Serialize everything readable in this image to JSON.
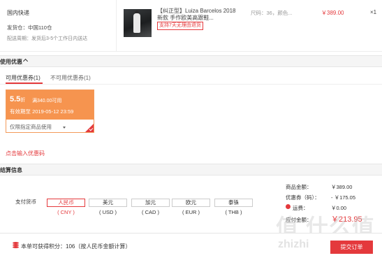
{
  "shipping": {
    "title": "国内快递",
    "from_line": "发货仓：中国110仓",
    "delivery_line": "配送周期：发货后3-5个工作日内送达"
  },
  "product": {
    "title": "【纠正型】Luiza Barcelos 2018新款 手作欧美高跟鞋...",
    "tag": "支持7天无理由退货",
    "sku": "尺码：36，颜色...",
    "price": "￥389.00",
    "qty": "×1"
  },
  "coupon_section": {
    "header": "使用优惠",
    "tab_usable": "可用优惠券(1)",
    "tab_unusable": "不可用优惠券(1)",
    "coupon": {
      "discount": "5.5",
      "discount_unit": "折",
      "condition": "满340.00可用",
      "valid": "有效期至 2019-05-12 23:59",
      "scope": "仅限指定商品使用"
    },
    "redeem_link": "点击输入优惠码"
  },
  "settlement": {
    "header": "结算信息",
    "currency_label": "支付货币",
    "currencies": [
      {
        "name": "人民币",
        "code": "( CNY )"
      },
      {
        "name": "美元",
        "code": "( USD )"
      },
      {
        "name": "加元",
        "code": "( CAD )"
      },
      {
        "name": "欧元",
        "code": "( EUR )"
      },
      {
        "name": "泰铢",
        "code": "( THB )"
      }
    ],
    "selected_currency": "CNY",
    "summary": {
      "goods_label": "商品金额：",
      "goods_value": "￥389.00",
      "coupon_label": "优惠券（码）：",
      "coupon_value": "- ￥175.05",
      "other_label": "运费：",
      "other_value": "￥0.00",
      "total_label": "应付金额：",
      "total_value": "￥213.95"
    }
  },
  "bottom": {
    "points_text": "本单可获得积分：106（按人民币金额计算）",
    "submit_label": "提交订单"
  },
  "watermark": {
    "big": "值 什么值",
    "small": "zhizhi"
  },
  "colors": {
    "accent": "#e4393c",
    "coupon": "#f6944f"
  }
}
